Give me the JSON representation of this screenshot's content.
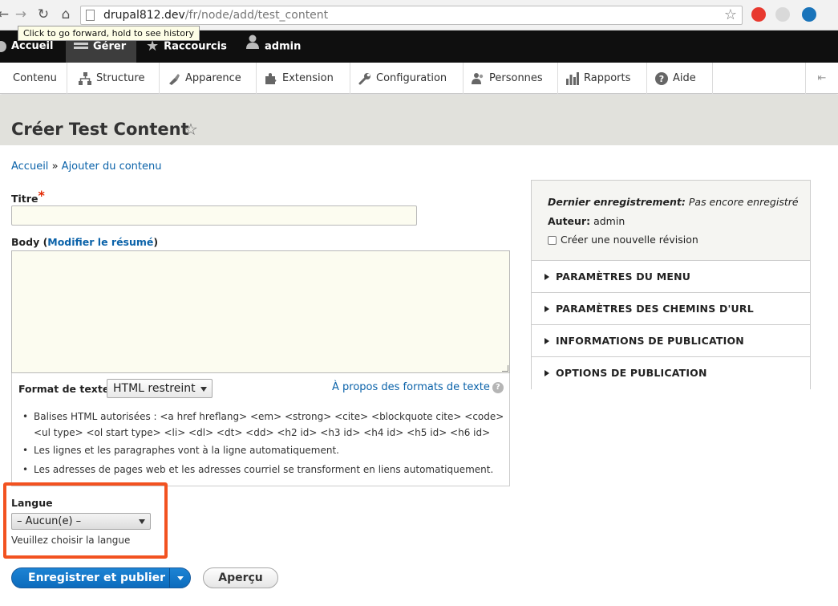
{
  "browser": {
    "url_host": "drupal812.dev",
    "url_path": "/fr/node/add/test_content",
    "tooltip": "Click to go forward, hold to see history"
  },
  "toolbar": {
    "home": "Accueil",
    "manage": "Gérer",
    "shortcuts": "Raccourcis",
    "user": "admin"
  },
  "tray": {
    "items": [
      {
        "label": "Contenu",
        "icon": "content-icon"
      },
      {
        "label": "Structure",
        "icon": "structure-icon"
      },
      {
        "label": "Apparence",
        "icon": "appearance-icon"
      },
      {
        "label": "Extension",
        "icon": "extension-icon"
      },
      {
        "label": "Configuration",
        "icon": "wrench-icon"
      },
      {
        "label": "Personnes",
        "icon": "people-icon"
      },
      {
        "label": "Rapports",
        "icon": "reports-icon"
      },
      {
        "label": "Aide",
        "icon": "help-icon"
      }
    ]
  },
  "page": {
    "title": "Créer Test Content"
  },
  "breadcrumb": {
    "home": "Accueil",
    "sep": "»",
    "current": "Ajouter du contenu"
  },
  "form": {
    "title_label": "Titre",
    "required_mark": "*",
    "body_label_start": "Body (",
    "body_summary_link": "Modifier le résumé",
    "body_label_end": ")",
    "format_label": "Format de texte",
    "format_value": "HTML restreint",
    "format_help": "À propos des formats de texte",
    "help_glyph": "?",
    "tips": [
      "Balises HTML autorisées : <a href hreflang> <em> <strong> <cite> <blockquote cite> <code>",
      "<ul type> <ol start type> <li> <dl> <dt> <dd> <h2 id> <h3 id> <h4 id> <h5 id> <h6 id>",
      "Les lignes et les paragraphes vont à la ligne automatiquement.",
      "Les adresses de pages web et les adresses courriel se transforment en liens automatiquement."
    ],
    "lang_label": "Langue",
    "lang_value": "– Aucun(e) –",
    "lang_desc": "Veuillez choisir la langue",
    "save_label": "Enregistrer et publier",
    "preview_label": "Aperçu"
  },
  "sidebar": {
    "last_saved_label": "Dernier enregistrement:",
    "last_saved_value": "Pas encore enregistré",
    "author_label": "Auteur:",
    "author_value": "admin",
    "revision_label": "Créer une nouvelle révision",
    "sections": [
      "PARAMÈTRES DU MENU",
      "PARAMÈTRES DES CHEMINS D'URL",
      "INFORMATIONS DE PUBLICATION",
      "OPTIONS DE PUBLICATION"
    ]
  },
  "colors": {
    "link": "#0a62a9",
    "primary_button": "#0c6bbd",
    "highlight": "#f25220",
    "toolbar_bg": "#0f0f0f"
  }
}
